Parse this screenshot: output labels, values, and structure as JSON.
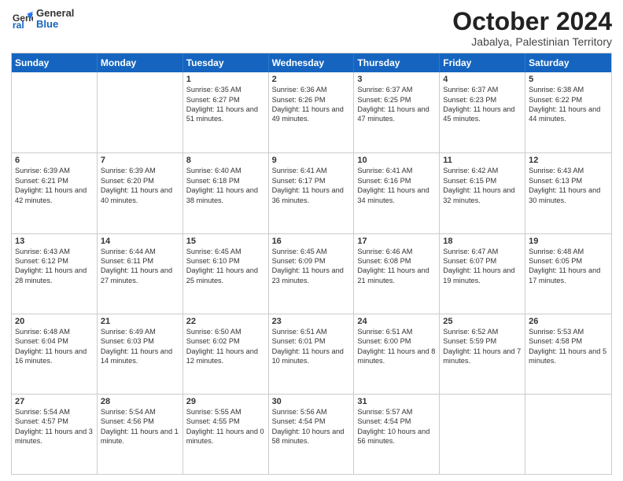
{
  "header": {
    "logo": {
      "general": "General",
      "blue": "Blue"
    },
    "month": "October 2024",
    "location": "Jabalya, Palestinian Territory"
  },
  "days_of_week": [
    "Sunday",
    "Monday",
    "Tuesday",
    "Wednesday",
    "Thursday",
    "Friday",
    "Saturday"
  ],
  "weeks": [
    [
      {
        "day": "",
        "info": ""
      },
      {
        "day": "",
        "info": ""
      },
      {
        "day": "1",
        "info": "Sunrise: 6:35 AM\nSunset: 6:27 PM\nDaylight: 11 hours\nand 51 minutes."
      },
      {
        "day": "2",
        "info": "Sunrise: 6:36 AM\nSunset: 6:26 PM\nDaylight: 11 hours\nand 49 minutes."
      },
      {
        "day": "3",
        "info": "Sunrise: 6:37 AM\nSunset: 6:25 PM\nDaylight: 11 hours\nand 47 minutes."
      },
      {
        "day": "4",
        "info": "Sunrise: 6:37 AM\nSunset: 6:23 PM\nDaylight: 11 hours\nand 45 minutes."
      },
      {
        "day": "5",
        "info": "Sunrise: 6:38 AM\nSunset: 6:22 PM\nDaylight: 11 hours\nand 44 minutes."
      }
    ],
    [
      {
        "day": "6",
        "info": "Sunrise: 6:39 AM\nSunset: 6:21 PM\nDaylight: 11 hours\nand 42 minutes."
      },
      {
        "day": "7",
        "info": "Sunrise: 6:39 AM\nSunset: 6:20 PM\nDaylight: 11 hours\nand 40 minutes."
      },
      {
        "day": "8",
        "info": "Sunrise: 6:40 AM\nSunset: 6:18 PM\nDaylight: 11 hours\nand 38 minutes."
      },
      {
        "day": "9",
        "info": "Sunrise: 6:41 AM\nSunset: 6:17 PM\nDaylight: 11 hours\nand 36 minutes."
      },
      {
        "day": "10",
        "info": "Sunrise: 6:41 AM\nSunset: 6:16 PM\nDaylight: 11 hours\nand 34 minutes."
      },
      {
        "day": "11",
        "info": "Sunrise: 6:42 AM\nSunset: 6:15 PM\nDaylight: 11 hours\nand 32 minutes."
      },
      {
        "day": "12",
        "info": "Sunrise: 6:43 AM\nSunset: 6:13 PM\nDaylight: 11 hours\nand 30 minutes."
      }
    ],
    [
      {
        "day": "13",
        "info": "Sunrise: 6:43 AM\nSunset: 6:12 PM\nDaylight: 11 hours\nand 28 minutes."
      },
      {
        "day": "14",
        "info": "Sunrise: 6:44 AM\nSunset: 6:11 PM\nDaylight: 11 hours\nand 27 minutes."
      },
      {
        "day": "15",
        "info": "Sunrise: 6:45 AM\nSunset: 6:10 PM\nDaylight: 11 hours\nand 25 minutes."
      },
      {
        "day": "16",
        "info": "Sunrise: 6:45 AM\nSunset: 6:09 PM\nDaylight: 11 hours\nand 23 minutes."
      },
      {
        "day": "17",
        "info": "Sunrise: 6:46 AM\nSunset: 6:08 PM\nDaylight: 11 hours\nand 21 minutes."
      },
      {
        "day": "18",
        "info": "Sunrise: 6:47 AM\nSunset: 6:07 PM\nDaylight: 11 hours\nand 19 minutes."
      },
      {
        "day": "19",
        "info": "Sunrise: 6:48 AM\nSunset: 6:05 PM\nDaylight: 11 hours\nand 17 minutes."
      }
    ],
    [
      {
        "day": "20",
        "info": "Sunrise: 6:48 AM\nSunset: 6:04 PM\nDaylight: 11 hours\nand 16 minutes."
      },
      {
        "day": "21",
        "info": "Sunrise: 6:49 AM\nSunset: 6:03 PM\nDaylight: 11 hours\nand 14 minutes."
      },
      {
        "day": "22",
        "info": "Sunrise: 6:50 AM\nSunset: 6:02 PM\nDaylight: 11 hours\nand 12 minutes."
      },
      {
        "day": "23",
        "info": "Sunrise: 6:51 AM\nSunset: 6:01 PM\nDaylight: 11 hours\nand 10 minutes."
      },
      {
        "day": "24",
        "info": "Sunrise: 6:51 AM\nSunset: 6:00 PM\nDaylight: 11 hours\nand 8 minutes."
      },
      {
        "day": "25",
        "info": "Sunrise: 6:52 AM\nSunset: 5:59 PM\nDaylight: 11 hours\nand 7 minutes."
      },
      {
        "day": "26",
        "info": "Sunrise: 5:53 AM\nSunset: 4:58 PM\nDaylight: 11 hours\nand 5 minutes."
      }
    ],
    [
      {
        "day": "27",
        "info": "Sunrise: 5:54 AM\nSunset: 4:57 PM\nDaylight: 11 hours\nand 3 minutes."
      },
      {
        "day": "28",
        "info": "Sunrise: 5:54 AM\nSunset: 4:56 PM\nDaylight: 11 hours\nand 1 minute."
      },
      {
        "day": "29",
        "info": "Sunrise: 5:55 AM\nSunset: 4:55 PM\nDaylight: 11 hours\nand 0 minutes."
      },
      {
        "day": "30",
        "info": "Sunrise: 5:56 AM\nSunset: 4:54 PM\nDaylight: 10 hours\nand 58 minutes."
      },
      {
        "day": "31",
        "info": "Sunrise: 5:57 AM\nSunset: 4:54 PM\nDaylight: 10 hours\nand 56 minutes."
      },
      {
        "day": "",
        "info": ""
      },
      {
        "day": "",
        "info": ""
      }
    ]
  ]
}
